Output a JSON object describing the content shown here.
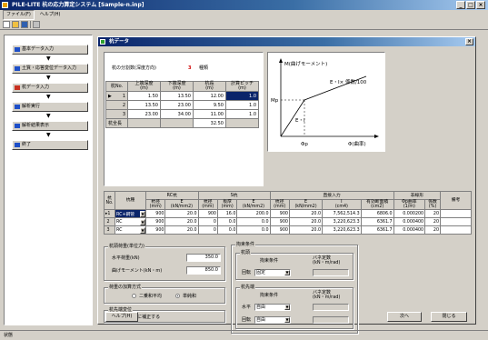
{
  "window": {
    "title": "PILE-LITE 杭の応力算定システム [Sample-n.inp]",
    "min": "_",
    "max": "□",
    "close": "×"
  },
  "menu": [
    "ファイル(F)",
    "ヘルプ(H)"
  ],
  "nav": [
    "基本データ入力",
    "土質・応答変位データ入力",
    "杭データ入力",
    "解析実行",
    "解析結果表示",
    "終了"
  ],
  "nav_colors": [
    "#1e4fc8",
    "#1e4fc8",
    "#c83020",
    "#1e4fc8",
    "#1e4fc8",
    "#1e4fc8"
  ],
  "child": {
    "title": "杭データ",
    "close": "×"
  },
  "layers": {
    "label": "杭の分割数(深度方向)",
    "count": "3",
    "unit": "種類"
  },
  "layer_table": {
    "headers": [
      "杭No.",
      "上端深度\n(m)",
      "下端深度\n(m)",
      "杭長\n(m)",
      "計算ピッチ\n(m)"
    ],
    "rows": [
      {
        "marker": "▶",
        "no": "1",
        "top": "1.50",
        "bottom": "13.50",
        "length": "12.00",
        "pitch": "1.0"
      },
      {
        "marker": "",
        "no": "2",
        "top": "13.50",
        "bottom": "23.00",
        "length": "9.50",
        "pitch": "1.0"
      },
      {
        "marker": "",
        "no": "3",
        "top": "23.00",
        "bottom": "34.00",
        "length": "11.00",
        "pitch": "1.0"
      }
    ],
    "total_label": "杭全長",
    "total": "32.50"
  },
  "diagram": {
    "ylabel": "M(曲げモーメント)",
    "mp": "Mp",
    "ei": "E・I",
    "ei_ratio": "E・I× 係数/100",
    "phi_label": "Φ(曲率)",
    "phip": "Φp"
  },
  "pile_table": {
    "group_headers": {
      "rc": "RC杭",
      "s": "S杭",
      "direct": "直接入力",
      "nonlinear": "非線形"
    },
    "sub_headers": [
      "杭\nNo.",
      "杭種",
      "杭径\n(mm)",
      "E\n(kN/mm2)",
      "杭径\n(mm)",
      "板厚\n(mm)",
      "E\n(kN/mm2)",
      "杭径\n(mm)",
      "E\n(kN/mm2)",
      "I\n(cm4)",
      "有効断面積\n(cm2)",
      "Φp曲率\n(1/m)",
      "係数\n(%)",
      "備考"
    ],
    "rows": [
      {
        "no": "1",
        "type": "RC+鋼管",
        "c": [
          "900",
          "20.0",
          "900",
          "16.0",
          "200.0",
          "900",
          "20.0",
          "7,562,514.3",
          "6806.0",
          "0.000200",
          "20",
          ""
        ]
      },
      {
        "no": "2",
        "type": "RC",
        "c": [
          "900",
          "20.0",
          "0",
          "0.0",
          "0.0",
          "900",
          "20.0",
          "3,220,623.3",
          "6361.7",
          "0.000400",
          "20",
          ""
        ]
      },
      {
        "no": "3",
        "type": "RC",
        "c": [
          "900",
          "20.0",
          "0",
          "0.0",
          "0.0",
          "900",
          "20.0",
          "3,220,623.3",
          "6361.7",
          "0.000400",
          "20",
          ""
        ]
      }
    ]
  },
  "head_load": {
    "title": "杭頭荷重(単位力)",
    "h_label": "水平荷重(kN)",
    "h_value": "350.0",
    "m_label": "曲げモーメント(kN・m)",
    "m_value": "850.0"
  },
  "method": {
    "title": "荷重の加算方式",
    "opt1": "二乗和平均",
    "opt2": "単純和"
  },
  "disp": {
    "title": "杭先端変位",
    "check": "0に補正する",
    "mark": "✓"
  },
  "restraint": {
    "title": "拘束条件",
    "head": {
      "title": "杭頭",
      "cond_label": "拘束条件",
      "spring_label": "バネ定数\n(kN・m/rad)",
      "rot_label": "回転",
      "rot_value": "固定"
    },
    "tip": {
      "title": "杭先端",
      "cond_label": "拘束条件",
      "spring_label": "バネ定数\n(kN・m/rad)",
      "h_label": "水平",
      "h_value": "自由",
      "rot_label": "回転",
      "rot_value": "自由"
    }
  },
  "buttons": {
    "help": "ヘルプ(H)",
    "next": "次へ",
    "close": "閉じる"
  },
  "status": "状態"
}
